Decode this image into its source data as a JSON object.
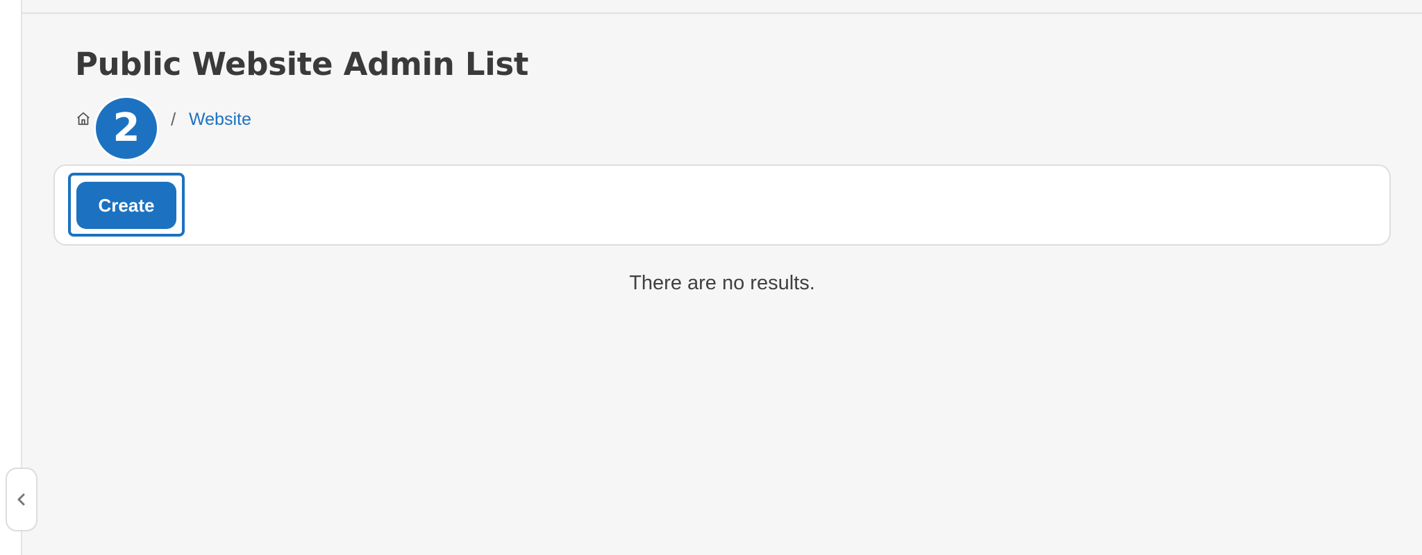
{
  "header": {
    "title": "Public Website Admin List"
  },
  "breadcrumb": {
    "home_icon": "home-icon",
    "separator": "/",
    "current": "Website"
  },
  "step_badge": {
    "number": "2"
  },
  "toolbar": {
    "create_label": "Create"
  },
  "main": {
    "empty_message": "There are no results."
  },
  "sidebar": {
    "collapse_icon": "chevron-left-icon"
  },
  "colors": {
    "accent": "#1c72c0",
    "background": "#f6f6f6",
    "title_text": "#3a3a3a"
  }
}
